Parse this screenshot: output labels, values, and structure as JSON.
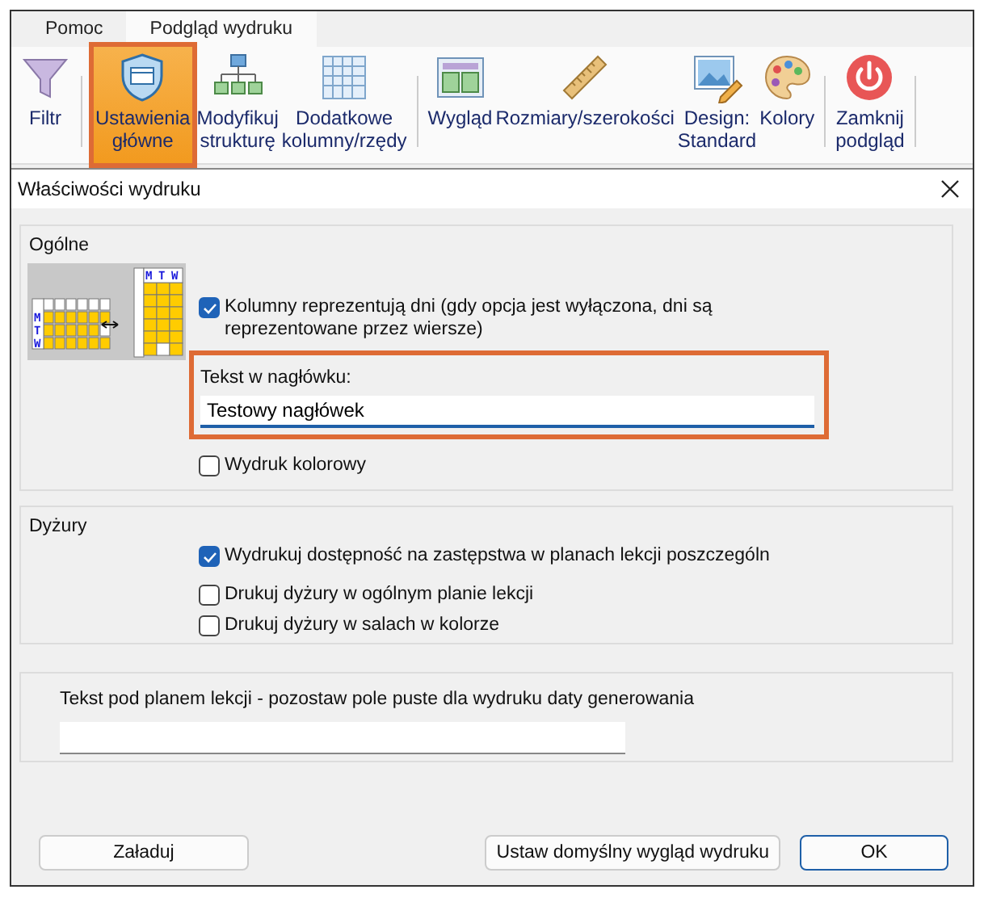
{
  "ribbon": {
    "tabs": [
      {
        "label": "Pomoc",
        "selected": false
      },
      {
        "label": "Podgląd wydruku",
        "selected": true
      }
    ],
    "groups": [
      {
        "buttons": [
          {
            "label": "Filtr",
            "selected": false,
            "highlighted": false
          }
        ]
      },
      {
        "buttons": [
          {
            "label": "Ustawienia\ngłówne",
            "selected": true,
            "highlighted": true
          },
          {
            "label": "Modyfikuj\nstrukturę",
            "selected": false,
            "highlighted": false
          },
          {
            "label": "Dodatkowe\nkolumny/rzędy",
            "selected": false,
            "highlighted": false
          }
        ]
      },
      {
        "buttons": [
          {
            "label": "Wygląd",
            "selected": false,
            "highlighted": false
          },
          {
            "label": "Rozmiary/szerokości",
            "selected": false,
            "highlighted": false
          },
          {
            "label": "Design:\nStandard",
            "selected": false,
            "highlighted": false
          },
          {
            "label": "Kolory",
            "selected": false,
            "highlighted": false
          }
        ]
      },
      {
        "buttons": [
          {
            "label": "Zamknij\npodgląd",
            "selected": false,
            "highlighted": false
          }
        ]
      }
    ]
  },
  "dialog": {
    "title": "Właściwości wydruku",
    "general": {
      "title": "Ogólne",
      "illustration": {
        "row_labels": [
          "M",
          "T",
          "W"
        ],
        "column_labels": [
          "M",
          "T",
          "W"
        ]
      },
      "columns_are_days": {
        "label": "Kolumny reprezentują dni (gdy opcja jest wyłączona, dni są reprezentowane przez wiersze)",
        "checked": true
      },
      "header_text": {
        "label": "Tekst w nagłówku:",
        "value": "Testowy nagłówek",
        "highlighted": true,
        "focused": true
      },
      "color_print": {
        "label": "Wydruk kolorowy",
        "checked": false
      }
    },
    "duties": {
      "title": "Dyżury",
      "options": [
        {
          "label": "Wydrukuj dostępność na zastępstwa w planach lekcji poszczególn",
          "checked": true
        },
        {
          "label": "Drukuj dyżury w ogólnym planie lekcji",
          "checked": false
        },
        {
          "label": "Drukuj dyżury w salach w kolorze",
          "checked": false
        }
      ]
    },
    "footer_text": {
      "label": "Tekst pod planem lekcji - pozostaw pole puste dla wydruku daty generowania"
    },
    "buttons": [
      {
        "label": "Załaduj",
        "default": false
      },
      {
        "label": "Ustaw domyślny wygląd wydruku",
        "default": false
      },
      {
        "label": "OK",
        "default": true
      }
    ]
  }
}
